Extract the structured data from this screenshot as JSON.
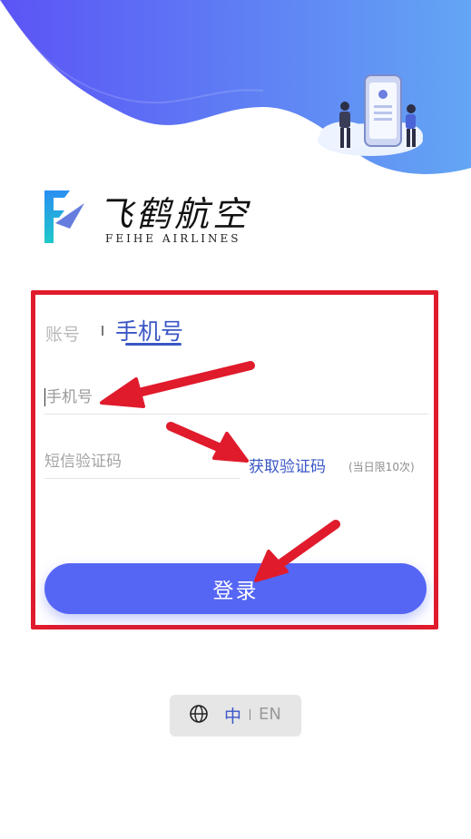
{
  "brand": {
    "name_cn": "飞鹤航空",
    "name_en": "FEIHE AIRLINES",
    "primary_color": "#5566f5",
    "accent_color": "#3b57c6"
  },
  "tabs": [
    {
      "label": "账号",
      "active": false
    },
    {
      "label": "手机号",
      "active": true
    }
  ],
  "form": {
    "phone_placeholder": "手机号",
    "sms_placeholder": "短信验证码",
    "get_code_label": "获取验证码",
    "daily_limit": "(当日限10次)",
    "login_label": "登录"
  },
  "language": {
    "zh": "中",
    "en": "EN",
    "selected": "中"
  },
  "annotations": {
    "highlight_color": "#e01b2c"
  }
}
